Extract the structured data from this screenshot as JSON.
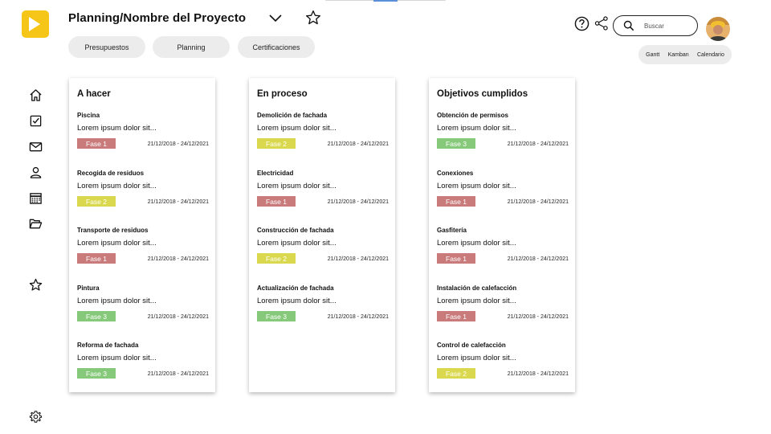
{
  "app": {
    "title": "Planning/Nombre del Proyecto",
    "icons": {
      "logo": "logo-icon",
      "chevron": "chevron-down-icon",
      "favorite": "star-icon"
    }
  },
  "tabs": [
    {
      "label": "Presupuestos"
    },
    {
      "label": "Planning"
    },
    {
      "label": "Certificaciones"
    }
  ],
  "header": {
    "search_placeholder": "Buscar",
    "icons": {
      "help": "help-icon",
      "share": "share-icon",
      "search": "search-icon",
      "avatar": "avatar"
    }
  },
  "views": [
    "Gantt",
    "Kamban",
    "Calendario"
  ],
  "sidebar": [
    {
      "icon": "home-icon"
    },
    {
      "icon": "checklist-icon"
    },
    {
      "icon": "mail-icon"
    },
    {
      "icon": "user-icon"
    },
    {
      "icon": "calendar-icon"
    },
    {
      "icon": "folder-icon"
    },
    {
      "icon": "star-icon"
    },
    {
      "icon": "gear-icon"
    }
  ],
  "phase_colors": {
    "Fase 1": "#c97b7b",
    "Fase 2": "#d9d84e",
    "Fase 3": "#86c97a"
  },
  "columns": [
    {
      "title": "A hacer",
      "cards": [
        {
          "title": "Piscina",
          "description": "Lorem ipsum dolor sit...",
          "phase": "Fase 1",
          "dates": "21/12/2018 - 24/12/2021"
        },
        {
          "title": "Recogida de residuos",
          "description": "Lorem ipsum dolor sit...",
          "phase": "Fase 2",
          "dates": "21/12/2018 - 24/12/2021"
        },
        {
          "title": "Transporte de residuos",
          "description": "Lorem ipsum dolor sit...",
          "phase": "Fase 1",
          "dates": "21/12/2018 - 24/12/2021"
        },
        {
          "title": "Pintura",
          "description": "Lorem ipsum dolor sit...",
          "phase": "Fase 3",
          "dates": "21/12/2018 - 24/12/2021"
        },
        {
          "title": "Reforma de fachada",
          "description": "Lorem ipsum dolor sit...",
          "phase": "Fase 3",
          "dates": "21/12/2018 - 24/12/2021"
        }
      ]
    },
    {
      "title": "En proceso",
      "cards": [
        {
          "title": "Demolición de fachada",
          "description": "Lorem ipsum dolor sit...",
          "phase": "Fase 2",
          "dates": "21/12/2018 - 24/12/2021"
        },
        {
          "title": "Electricidad",
          "description": "Lorem ipsum dolor sit...",
          "phase": "Fase 1",
          "dates": "21/12/2018 - 24/12/2021"
        },
        {
          "title": "Construcción de fachada",
          "description": "Lorem ipsum dolor sit...",
          "phase": "Fase 2",
          "dates": "21/12/2018 - 24/12/2021"
        },
        {
          "title": "Actualización de fachada",
          "description": "Lorem ipsum dolor sit...",
          "phase": "Fase 3",
          "dates": "21/12/2018 - 24/12/2021"
        }
      ]
    },
    {
      "title": "Objetivos cumplidos",
      "cards": [
        {
          "title": "Obtención de permisos",
          "description": "Lorem ipsum dolor sit...",
          "phase": "Fase 3",
          "dates": "21/12/2018 - 24/12/2021"
        },
        {
          "title": "Conexiones",
          "description": "Lorem ipsum dolor sit...",
          "phase": "Fase 1",
          "dates": "21/12/2018 - 24/12/2021"
        },
        {
          "title": "Gasfitería",
          "description": "Lorem ipsum dolor sit...",
          "phase": "Fase 1",
          "dates": "21/12/2018 - 24/12/2021"
        },
        {
          "title": "Instalación de calefacción",
          "description": "Lorem ipsum dolor sit...",
          "phase": "Fase 1",
          "dates": "21/12/2018 - 24/12/2021"
        },
        {
          "title": "Control de calefacción",
          "description": "Lorem ipsum dolor sit...",
          "phase": "Fase 2",
          "dates": "21/12/2018 - 24/12/2021"
        }
      ]
    }
  ]
}
